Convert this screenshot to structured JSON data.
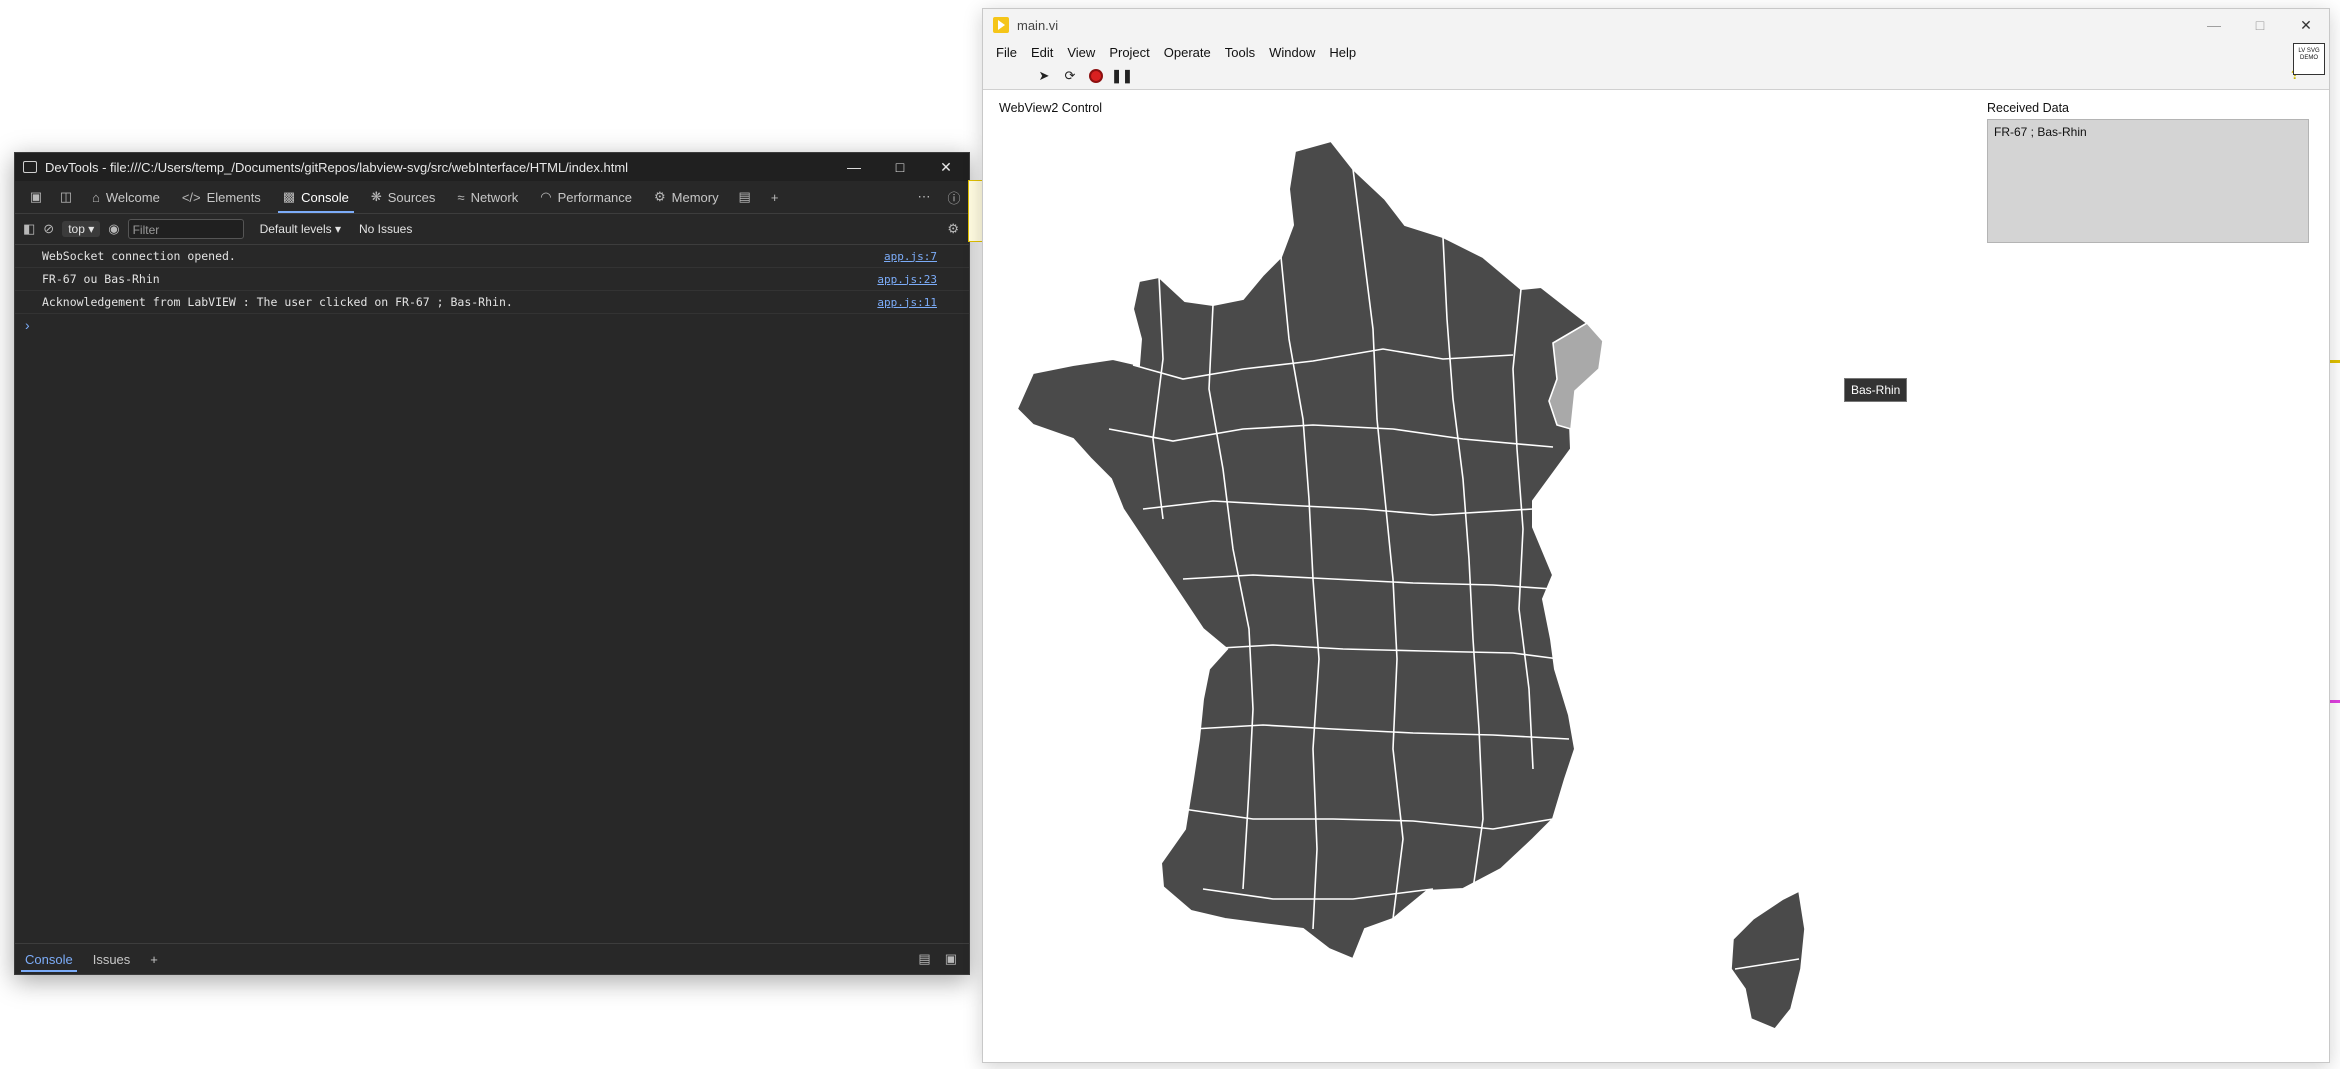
{
  "devtools": {
    "title": "DevTools - file:///C:/Users/temp_/Documents/gitRepos/labview-svg/src/webInterface/HTML/index.html",
    "tabs": [
      {
        "label": "Welcome",
        "icon": "home-icon"
      },
      {
        "label": "Elements",
        "icon": "code-icon"
      },
      {
        "label": "Console",
        "icon": "console-icon",
        "active": true
      },
      {
        "label": "Sources",
        "icon": "bug-icon"
      },
      {
        "label": "Network",
        "icon": "wifi-icon"
      },
      {
        "label": "Performance",
        "icon": "gauge-icon"
      },
      {
        "label": "Memory",
        "icon": "gear-chip-icon"
      }
    ],
    "toolbar": {
      "context": "top",
      "filter_placeholder": "Filter",
      "levels": "Default levels",
      "issues": "No Issues"
    },
    "messages": [
      {
        "text": "WebSocket connection opened.",
        "source": "app.js:7"
      },
      {
        "text": "FR-67 ou Bas-Rhin",
        "source": "app.js:23"
      },
      {
        "text": "Acknowledgement from LabVIEW : The user clicked on FR-67 ; Bas-Rhin.",
        "source": "app.js:11"
      }
    ],
    "prompt": "›",
    "drawer": {
      "console": "Console",
      "issues": "Issues"
    }
  },
  "labview": {
    "title": "main.vi",
    "menu": [
      "File",
      "Edit",
      "View",
      "Project",
      "Operate",
      "Tools",
      "Window",
      "Help"
    ],
    "webview_label": "WebView2 Control",
    "received_label": "Received Data",
    "received_value": "FR-67 ; Bas-Rhin",
    "tooltip": "Bas-Rhin",
    "vi_icon_text": "LV SVG DEMO",
    "colors": {
      "map_fill": "#4a4a4a",
      "map_highlight": "#a9a9a9",
      "map_border": "#ffffff"
    }
  }
}
